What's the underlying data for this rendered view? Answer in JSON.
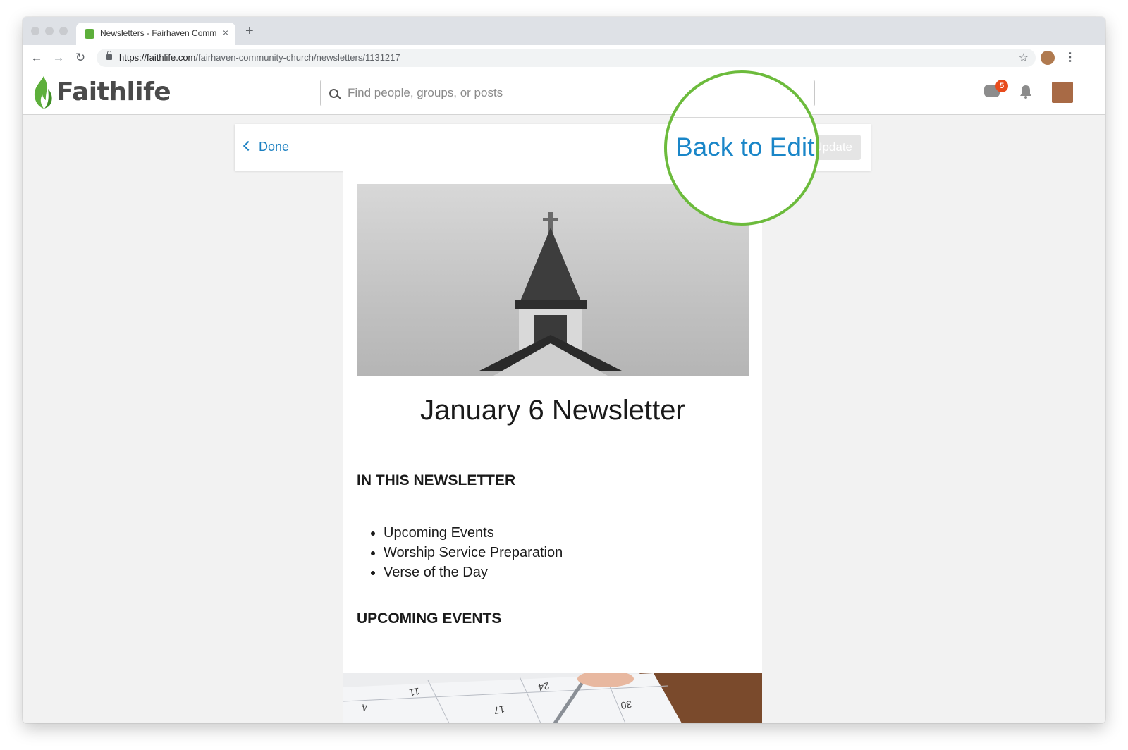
{
  "browser": {
    "tab_title": "Newsletters - Fairhaven Comm",
    "tab_close": "×",
    "new_tab": "+",
    "url_host": "https://faithlife.com",
    "url_path": "/fairhaven-community-church/newsletters/1131217",
    "back": "←",
    "forward": "→",
    "reload": "↻",
    "star": "☆",
    "menu": "⋮"
  },
  "site": {
    "logo_text": "Faithlife",
    "search_placeholder": "Find people, groups, or posts",
    "message_badge": "5",
    "brand_color": "#5daf3b"
  },
  "action_bar": {
    "done_label": "Done",
    "update_label": "Update"
  },
  "callout": {
    "label": "Back to Edit",
    "ring_color": "#6cbb3c"
  },
  "newsletter": {
    "title": "January 6 Newsletter",
    "section_in_this": "IN THIS NEWSLETTER",
    "toc": [
      "Upcoming Events",
      "Worship Service Preparation",
      "Verse of the Day"
    ],
    "section_upcoming": "UPCOMING EVENTS",
    "calendar_numbers": [
      "11",
      "24",
      "17",
      "30",
      "4"
    ]
  }
}
